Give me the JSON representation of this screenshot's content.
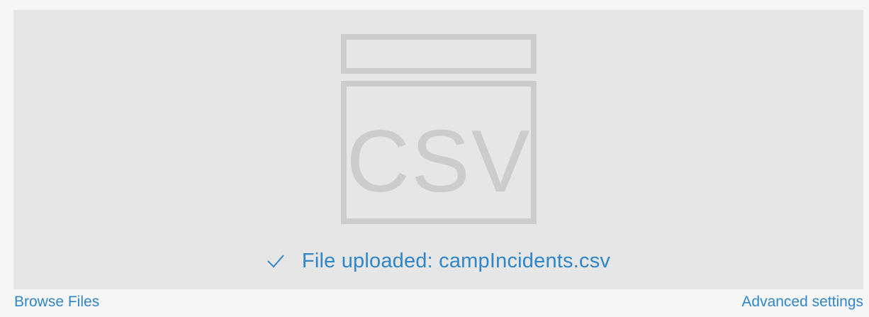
{
  "dropzone": {
    "icon": "csv-file-icon",
    "icon_text": "CSV",
    "status_icon": "checkmark-icon",
    "status_text": "File uploaded: campIncidents.csv"
  },
  "footer": {
    "browse_label": "Browse Files",
    "advanced_label": "Advanced settings"
  },
  "colors": {
    "link": "#2f86c9",
    "icon": "#cccccc",
    "dropzone_bg": "#e6e6e6",
    "page_bg": "#f6f6f6"
  }
}
